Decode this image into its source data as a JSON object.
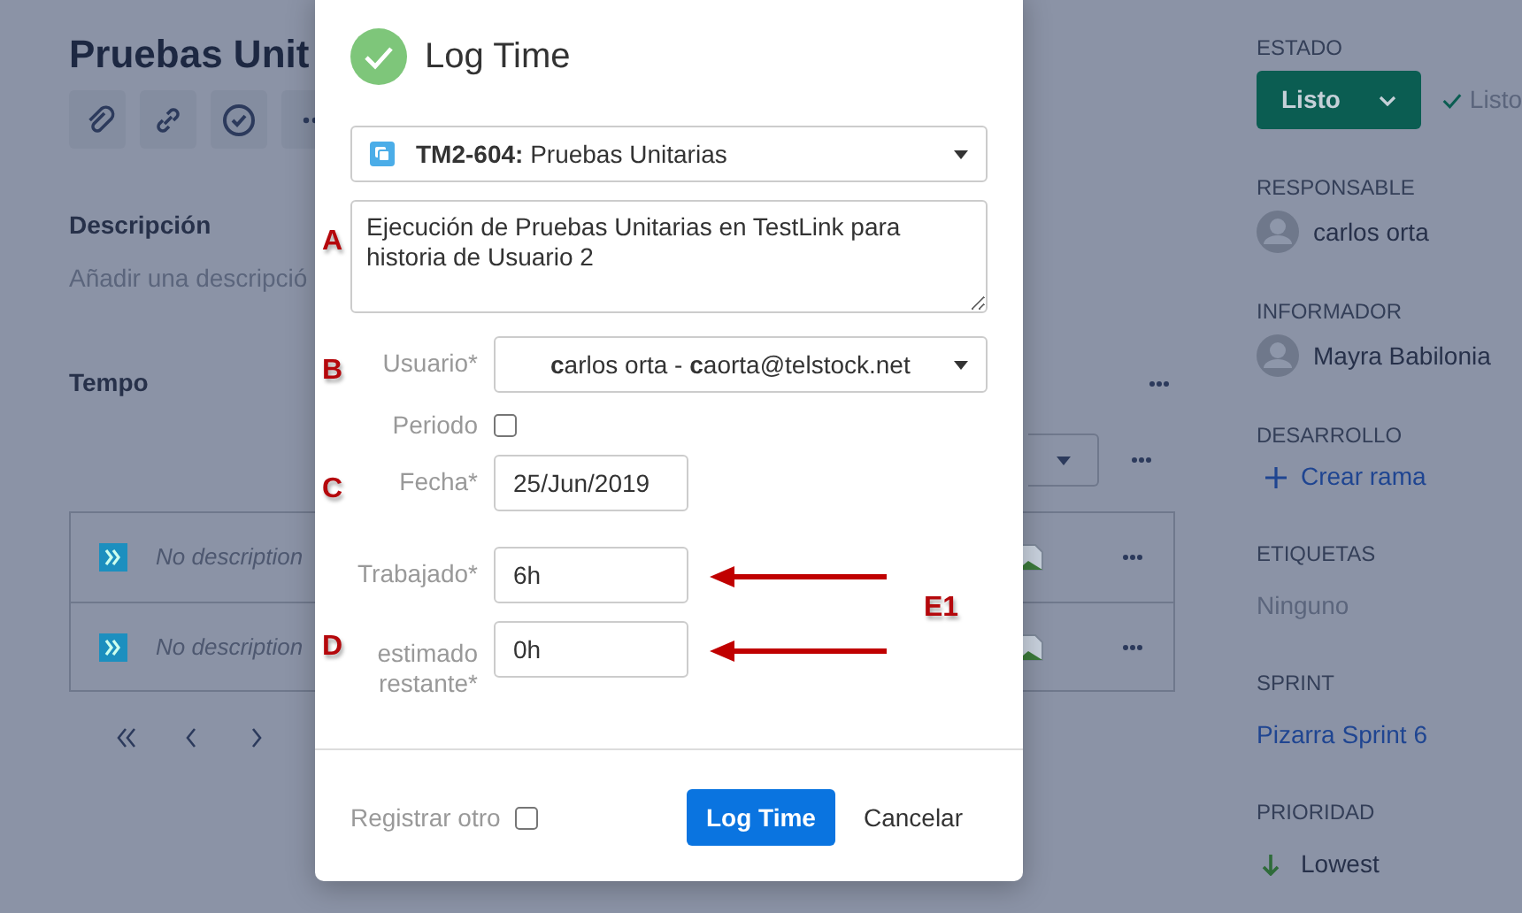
{
  "issue": {
    "title": "Pruebas Unit",
    "description_heading": "Descripción",
    "description_placeholder": "Añadir una descripció",
    "tempo_heading": "Tempo",
    "tempo_rows": [
      {
        "description": "No description"
      },
      {
        "description": "No description"
      }
    ]
  },
  "sidebar": [
    {
      "kind": "status",
      "label": "ESTADO",
      "value": "Listo",
      "resolution": "Listo"
    },
    {
      "kind": "user",
      "label": "RESPONSABLE",
      "value": "carlos orta"
    },
    {
      "kind": "user",
      "label": "INFORMADOR",
      "value": "Mayra Babilonia"
    },
    {
      "kind": "action",
      "label": "DESARROLLO",
      "value": "Crear rama"
    },
    {
      "kind": "plain",
      "label": "ETIQUETAS",
      "value": "Ninguno"
    },
    {
      "kind": "link",
      "label": "SPRINT",
      "value": "Pizarra Sprint 6"
    },
    {
      "kind": "priority",
      "label": "PRIORIDAD",
      "value": "Lowest"
    }
  ],
  "dialog": {
    "title": "Log Time",
    "issue_key": "TM2-604:",
    "issue_summary": "Pruebas Unitarias",
    "comment": {
      "value": "Ejecución de Pruebas Unitarias en TestLink para historia de Usuario 2",
      "marker": "A"
    },
    "fields": [
      {
        "kind": "select",
        "label": "Usuario*",
        "value": "**c**arlos orta - **c**aorta@telstock.net",
        "marker": "B",
        "arrow": false
      },
      {
        "kind": "checkbox",
        "label": "Periodo",
        "checked": false,
        "arrow": false
      },
      {
        "kind": "input",
        "label": "Fecha*",
        "value": "25/Jun/2019",
        "marker": "C",
        "arrow": false
      },
      {
        "kind": "input",
        "label": "Trabajado*",
        "value": "6h",
        "arrow": true
      },
      {
        "kind": "input",
        "label": "estimado restante*",
        "value": "0h",
        "marker": "D",
        "arrow": true
      }
    ],
    "side_note": "E1",
    "register_other": {
      "label": "Registrar otro",
      "checked": false
    },
    "buttons": [
      {
        "kind": "primary",
        "label": "Log Time"
      },
      {
        "kind": "link",
        "label": "Cancelar"
      }
    ]
  }
}
